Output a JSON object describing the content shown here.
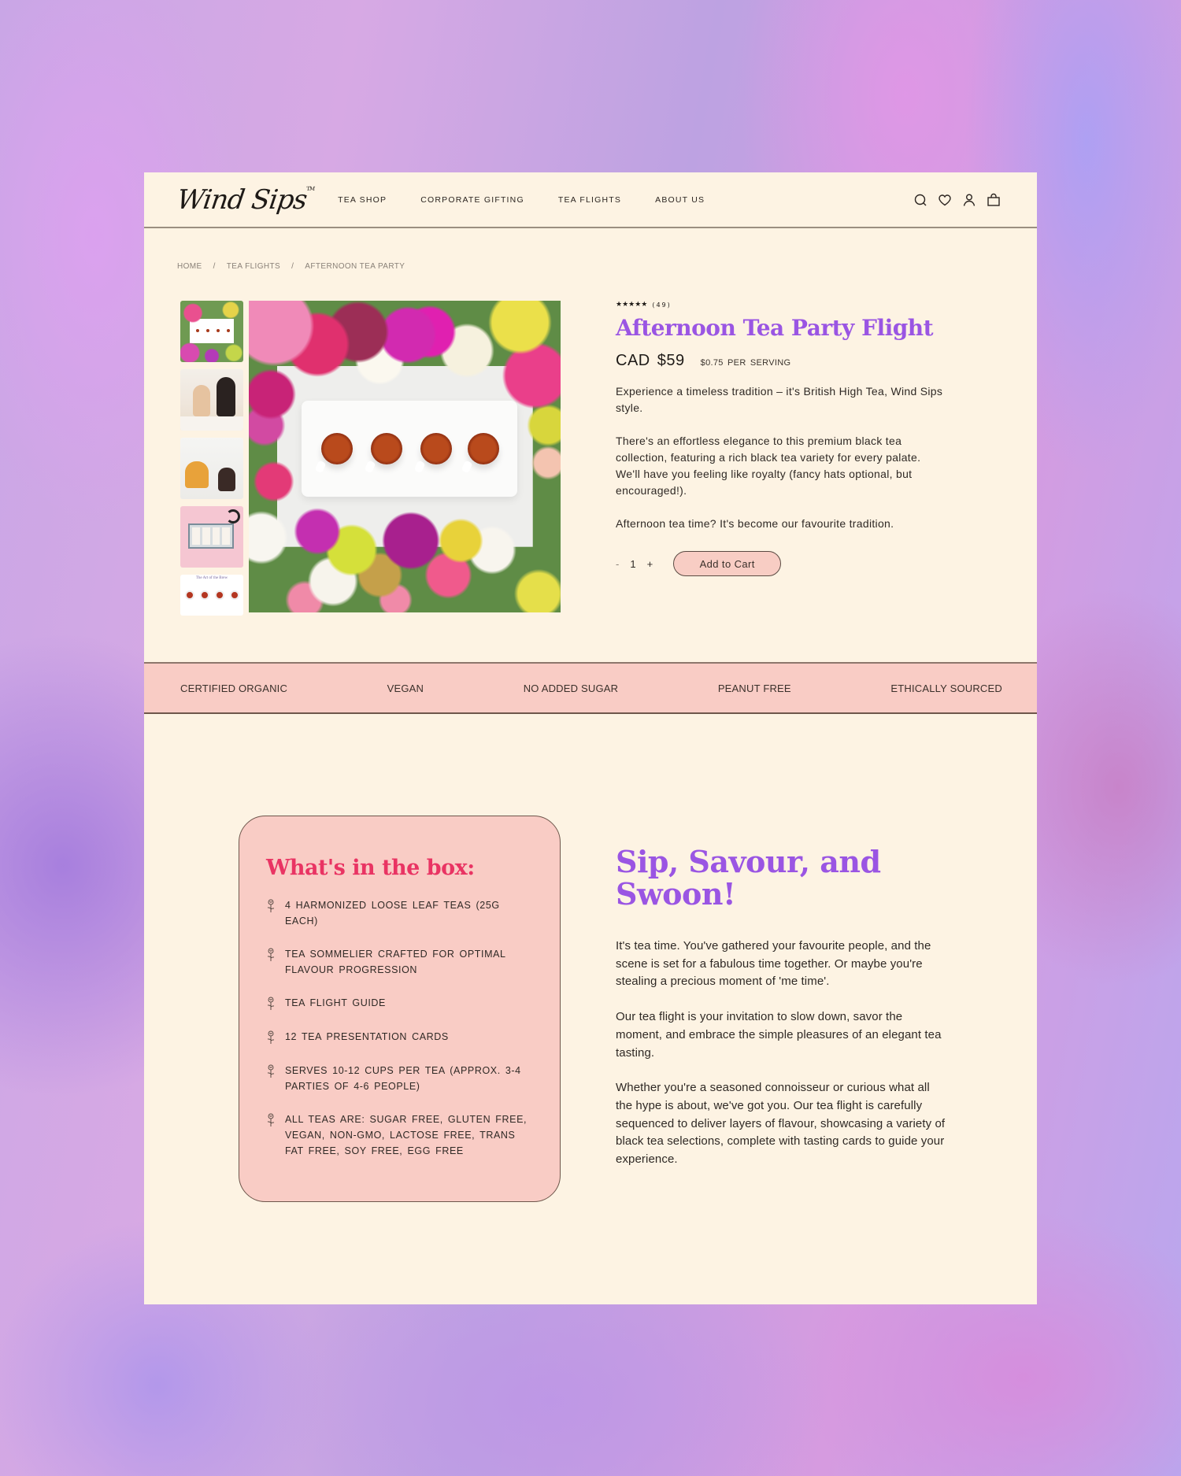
{
  "header": {
    "logo": "Wind Sips",
    "trademark": "TM",
    "nav": [
      {
        "label": "TEA SHOP"
      },
      {
        "label": "CORPORATE GIFTING"
      },
      {
        "label": "TEA FLIGHTS"
      },
      {
        "label": "ABOUT US"
      }
    ],
    "icons": [
      "search-icon",
      "heart-icon",
      "account-icon",
      "shopping-bag-icon"
    ]
  },
  "breadcrumb": {
    "items": [
      "HOME",
      "TEA FLIGHTS",
      "AFTERNOON TEA PARTY"
    ],
    "separator": "/"
  },
  "gallery": {
    "thumbnails": [
      {
        "alt": "Tea cups surrounded by flowers"
      },
      {
        "alt": "Two women serving tea"
      },
      {
        "alt": "Women chatting over tea"
      },
      {
        "alt": "Tea flight gift box on pink"
      },
      {
        "alt": "The Art of the Brew tasting card",
        "caption": "The Art of the Brew"
      }
    ],
    "main_alt": "Four tea cups on a white tray framed by colorful flowers"
  },
  "product": {
    "stars": "★★★★★",
    "rating_count": "(49)",
    "title": "Afternoon Tea Party Flight",
    "price": "CAD $59",
    "per_serving": "$0.75 PER SERVING",
    "description": [
      "Experience a timeless tradition – it's British High Tea, Wind Sips style.",
      "There's an effortless elegance to this premium black tea collection, featuring a rich black tea variety for every palate. We'll have you feeling like royalty (fancy hats optional, but encouraged!).",
      "Afternoon tea time? It's become our favourite tradition."
    ],
    "quantity": {
      "minus": "-",
      "value": "1",
      "plus": "+"
    },
    "add_to_cart": "Add to Cart"
  },
  "features": [
    "CERTIFIED ORGANIC",
    "VEGAN",
    "NO ADDED SUGAR",
    "PEANUT FREE",
    "ETHICALLY SOURCED"
  ],
  "box": {
    "title": "What's in the box:",
    "items": [
      "4 HARMONIZED LOOSE LEAF TEAS (25G EACH)",
      "TEA SOMMELIER CRAFTED FOR OPTIMAL FLAVOUR PROGRESSION",
      "TEA FLIGHT GUIDE",
      "12 TEA PRESENTATION CARDS",
      "SERVES 10-12 CUPS PER TEA (APPROX. 3-4 PARTIES OF 4-6 PEOPLE)",
      "ALL TEAS ARE: SUGAR FREE, GLUTEN FREE, VEGAN, NON-GMO, LACTOSE FREE, TRANS FAT FREE, SOY FREE, EGG FREE"
    ]
  },
  "story": {
    "heading": "Sip, Savour, and Swoon!",
    "paragraphs": [
      "It's tea time. You've gathered your favourite people, and the scene is set for a fabulous time together. Or maybe you're stealing a precious moment of 'me time'.",
      "Our tea flight is your invitation to slow down, savor the moment, and embrace the simple pleasures of an elegant tea tasting.",
      "Whether you're a seasoned connoisseur or curious what all the hype is about, we've got you. Our tea flight is carefully sequenced to deliver layers of flavour, showcasing a variety of black tea selections, complete with tasting cards to guide your experience."
    ]
  },
  "colors": {
    "page_bg": "#fdf3e3",
    "accent_purple": "#9a55e3",
    "accent_pink_heading": "#e93463",
    "band_pink": "#f9ccc5",
    "text": "#2f2925"
  }
}
